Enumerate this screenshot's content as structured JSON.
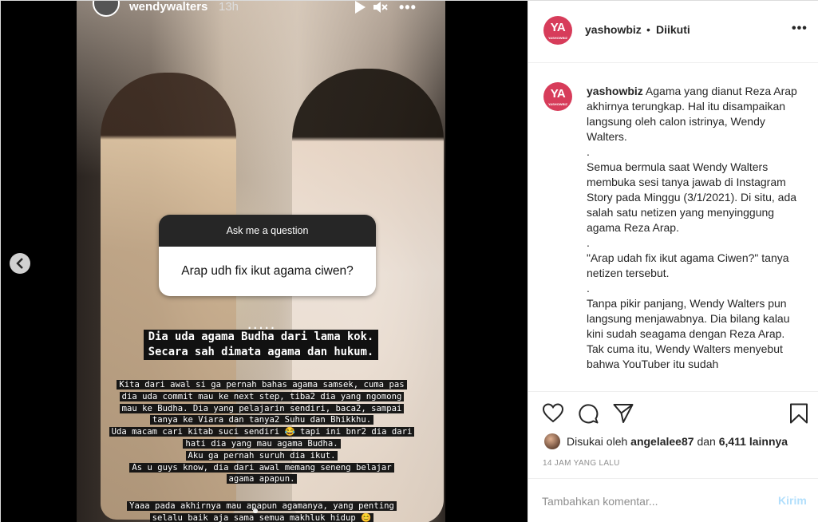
{
  "story": {
    "username": "wendywalters",
    "time": "13h",
    "question_title": "Ask me a question",
    "question_text": "Arap udh fix ikut agama ciwen?",
    "dots": ".....",
    "answer_bold": [
      "Dia uda agama Budha dari lama kok.",
      "Secara sah dimata agama dan hukum."
    ],
    "answer_body": [
      "Kita dari awal si ga pernah bahas agama samsek, cuma pas",
      "dia uda commit mau ke next step, tiba2 dia yang ngomong",
      "mau ke Budha. Dia yang pelajarin sendiri, baca2, sampai",
      "tanya ke Viara dan tanya2 Suhu dan Bhikkhu.",
      "Uda macam cari kitab suci sendiri 😂 tapi ini bnr2 dia dari",
      "hati dia yang mau agama Budha.",
      "Aku ga pernah suruh dia ikut.",
      "As u guys know, dia dari awal memang seneng belajar",
      "agama apapun."
    ],
    "answer_end": [
      "Yaaa pada akhirnya mau apapun agamanya, yang penting",
      "selalu baik aja sama semua makhluk hidup 😊"
    ],
    "more_icon": "more-dots-icon"
  },
  "header": {
    "avatar_text": "YA",
    "avatar_sub": "YASHOWBIZ",
    "username": "yashowbiz",
    "separator": "•",
    "follow_status": "Diikuti",
    "more_icon": "more-horizontal-icon"
  },
  "caption": {
    "username": "yashowbiz",
    "paragraphs": [
      "Agama yang dianut Reza Arap akhirnya terungkap. Hal itu disampaikan langsung oleh calon istrinya, Wendy Walters.",
      ".",
      "Semua bermula saat Wendy Walters membuka sesi tanya jawab di Instagram Story pada Minggu (3/1/2021). Di situ, ada salah satu netizen yang menyinggung agama Reza Arap.",
      ".",
      "\"Arap udah fix ikut agama Ciwen?\" tanya netizen tersebut.",
      ".",
      "Tanpa pikir panjang, Wendy Walters pun langsung menjawabnya. Dia bilang kalau kini sudah seagama dengan Reza Arap. Tak cuma itu, Wendy Walters menyebut bahwa YouTuber itu sudah"
    ]
  },
  "likes": {
    "prefix": "Disukai oleh",
    "user": "angelalee87",
    "connector": "dan",
    "others": "6,411 lainnya"
  },
  "timestamp": "14 JAM YANG LALU",
  "comment": {
    "placeholder": "Tambahkan komentar...",
    "post_label": "Kirim"
  },
  "colors": {
    "accent_avatar": "#d73c5a",
    "post_disabled": "#b2dffc",
    "text": "#262626",
    "muted": "#8e8e8e"
  }
}
